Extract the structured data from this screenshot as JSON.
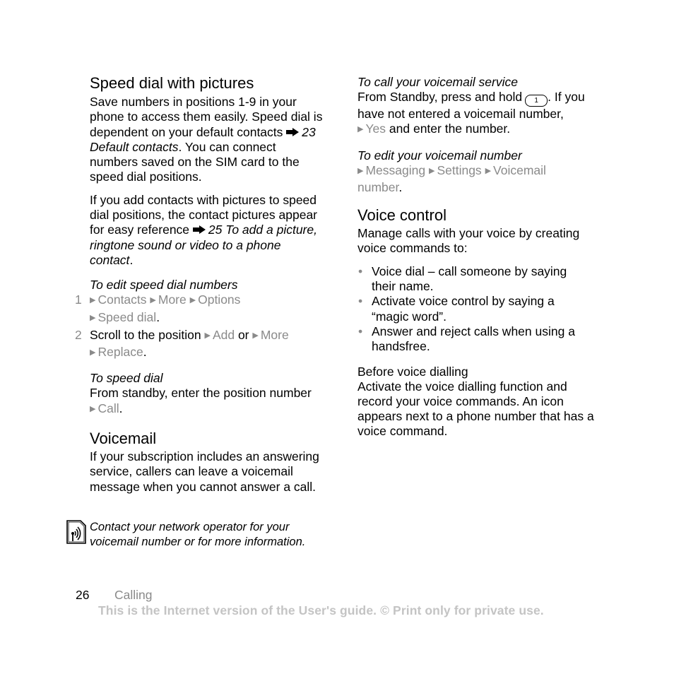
{
  "left": {
    "speed_dial": {
      "heading": "Speed dial with pictures",
      "para1": {
        "before_ref": "Save numbers in positions 1-9 in your phone to access them easily. Speed dial is dependent on your default contacts",
        "ref": "23 Default contacts",
        "after_ref": ". You can connect numbers saved on the SIM card to the speed dial positions."
      },
      "para2": {
        "before_ref": "If you add contacts with pictures to speed dial positions, the contact pictures appear for easy reference",
        "ref": "25 To add a picture, ringtone sound or video to a phone contact",
        "after_ref": "."
      },
      "edit_heading": "To edit speed dial numbers",
      "steps": [
        {
          "num": "1",
          "menu": [
            "Contacts",
            "More",
            "Options",
            "Speed dial"
          ],
          "end": "."
        },
        {
          "num": "2",
          "text": "Scroll to the position",
          "menu_a": "Add",
          "or": "or",
          "menu_b": "More",
          "menu_c": "Replace",
          "end": "."
        }
      ],
      "to_speed_dial_heading": "To speed dial",
      "to_speed_dial_text": "From standby, enter the position number",
      "to_speed_dial_menu": "Call",
      "to_speed_dial_end": "."
    },
    "voicemail": {
      "heading": "Voicemail",
      "text": "If your subscription includes an answering service, callers can leave a voicemail message when you cannot answer a call.",
      "note": "Contact your network operator for your voicemail number or for more information.",
      "note_icon": "network-operator-icon"
    }
  },
  "right": {
    "call_voicemail": {
      "heading": "To call your voicemail service",
      "text_before_key": "From Standby, press and hold",
      "key_label": "1",
      "text_after_key": ".",
      "text2_before": "If you have not entered a voicemail number,",
      "menu": "Yes",
      "text2_after": "and enter the number."
    },
    "edit_voicemail": {
      "heading": "To edit your voicemail number",
      "menu": [
        "Messaging",
        "Settings",
        "Voicemail number"
      ],
      "end": "."
    },
    "voice_control": {
      "heading": "Voice control",
      "intro": "Manage calls with your voice by creating voice commands to:",
      "bullets": [
        "Voice dial – call someone by saying their name.",
        "Activate voice control by saying a “magic word”.",
        "Answer and reject calls when using a handsfree."
      ],
      "before_heading": "Before voice dialling",
      "before_text": "Activate the voice dialling function and record your voice commands. An icon appears next to a phone number that has a voice command."
    }
  },
  "footer": {
    "page_number": "26",
    "section": "Calling",
    "notice": "This is the Internet version of the User's guide. © Print only for private use."
  },
  "colors": {
    "text": "#000000",
    "menu_gray": "#8a8a8a",
    "notice_gray": "#c4c4c4"
  }
}
